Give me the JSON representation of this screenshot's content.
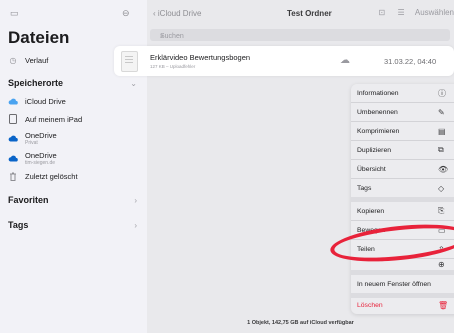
{
  "sidebar": {
    "title": "Dateien",
    "recents_label": "Verlauf",
    "locations_header": "Speicherorte",
    "locations": [
      {
        "label": "iCloud Drive",
        "sub": "",
        "icon": "cloud-icon"
      },
      {
        "label": "Auf meinem iPad",
        "sub": "",
        "icon": "ipad-icon"
      },
      {
        "label": "OneDrive",
        "sub": "Privat",
        "icon": "onedrive-icon"
      },
      {
        "label": "OneDrive",
        "sub": "tim-siegen.de",
        "icon": "onedrive-icon"
      },
      {
        "label": "Zuletzt gelöscht",
        "sub": "",
        "icon": "trash-icon"
      }
    ],
    "favorites_header": "Favoriten",
    "tags_header": "Tags"
  },
  "toolbar": {
    "back_label": "iCloud Drive",
    "folder_title": "Test Ordner",
    "select_label": "Auswählen"
  },
  "search": {
    "placeholder": "Suchen"
  },
  "file": {
    "name": "Erklärvideo Bewertungsbogen",
    "meta": "127 KB – Uploadfehler",
    "date": "31.03.22, 04:40"
  },
  "context_menu": {
    "group1": [
      {
        "label": "Informationen",
        "icon": "ⓘ"
      },
      {
        "label": "Umbenennen",
        "icon": "✎"
      },
      {
        "label": "Komprimieren",
        "icon": "▤"
      },
      {
        "label": "Duplizieren",
        "icon": "⧉"
      },
      {
        "label": "Übersicht",
        "icon": "👁"
      },
      {
        "label": "Tags",
        "icon": "◇"
      }
    ],
    "group2": [
      {
        "label": "Kopieren",
        "icon": "⎘"
      },
      {
        "label": "Bewegen",
        "icon": "▭"
      },
      {
        "label": "Teilen",
        "icon": "⇪"
      },
      {
        "label": "",
        "icon": "⊕"
      }
    ],
    "group3": [
      {
        "label": "In neuem Fenster öffnen",
        "icon": "⊞"
      }
    ],
    "delete": {
      "label": "Löschen",
      "icon": "🗑"
    }
  },
  "footer": {
    "status": "1 Objekt, 142,75 GB auf iCloud verfügbar"
  },
  "colors": {
    "accent": "#007aff",
    "danger": "#e8223a"
  }
}
